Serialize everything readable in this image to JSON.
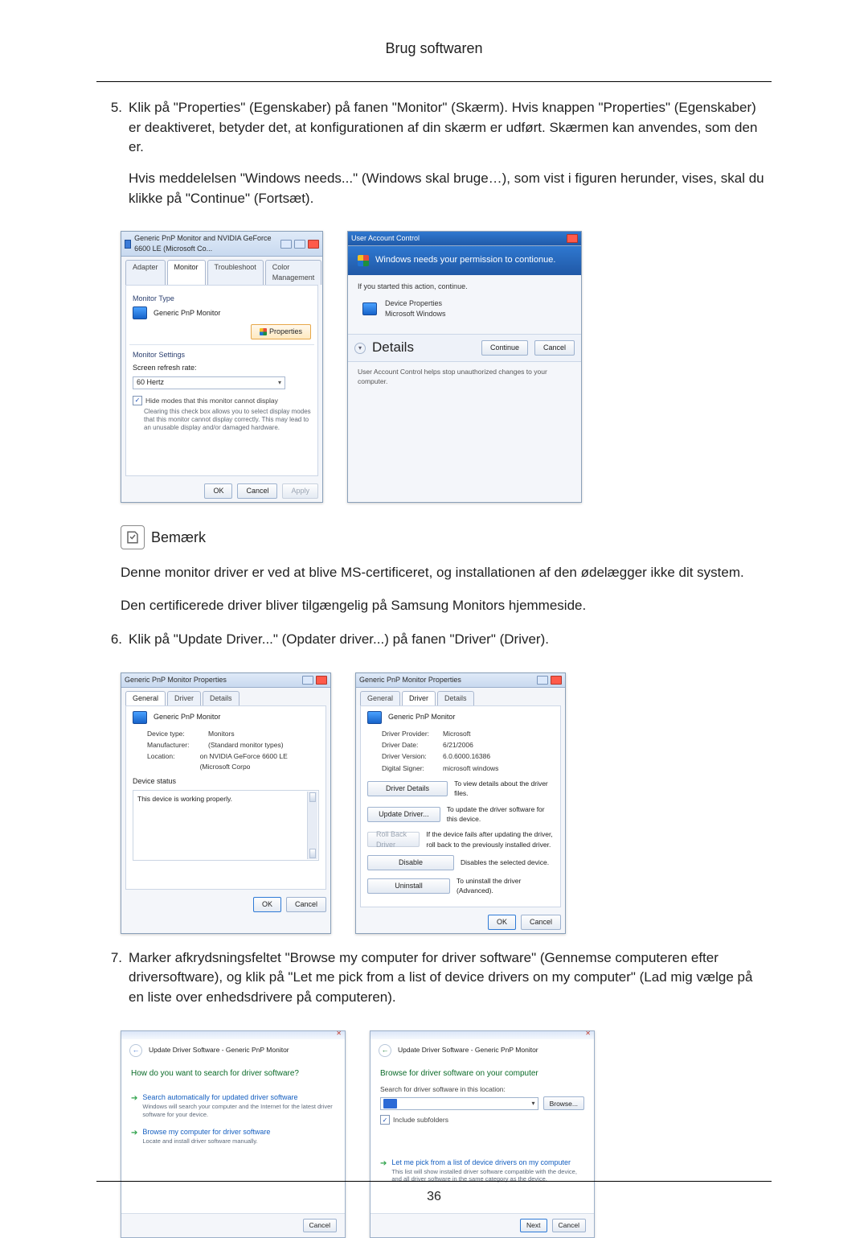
{
  "header": {
    "title": "Brug softwaren"
  },
  "page_number": "36",
  "steps": {
    "five": {
      "num": "5.",
      "para1": "Klik på \"Properties\" (Egenskaber) på fanen \"Monitor\" (Skærm). Hvis knappen \"Properties\" (Egenskaber) er deaktiveret, betyder det, at konfigurationen af din skærm er udført. Skærmen kan anvendes, som den er.",
      "para2": "Hvis meddelelsen \"Windows needs...\" (Windows skal bruge…), som vist i figuren herunder, vises, skal du klikke på \"Continue\" (Fortsæt)."
    },
    "six": {
      "num": "6.",
      "text": "Klik på \"Update Driver...\" (Opdater driver...) på fanen \"Driver\" (Driver)."
    },
    "seven": {
      "num": "7.",
      "text": "Marker afkrydsningsfeltet \"Browse my computer for driver software\" (Gennemse computeren efter driversoftware), og klik på \"Let me pick from a list of device drivers on my computer\" (Lad mig vælge på en liste over enhedsdrivere på computeren)."
    }
  },
  "note": {
    "label": "Bemærk",
    "para1": "Denne monitor driver er ved at blive MS-certificeret, og installationen af den ødelægger ikke dit system.",
    "para2": "Den certificerede driver bliver tilgængelig på Samsung Monitors hjemmeside."
  },
  "fig1_monitor_tab": {
    "title": "Generic PnP Monitor and NVIDIA GeForce 6600 LE (Microsoft Co...",
    "tabs": {
      "adapter": "Adapter",
      "monitor": "Monitor",
      "trouble": "Troubleshoot",
      "color": "Color Management"
    },
    "monitor_type_label": "Monitor Type",
    "monitor_type_value": "Generic PnP Monitor",
    "properties_btn": "Properties",
    "monitor_settings_label": "Monitor Settings",
    "refresh_label": "Screen refresh rate:",
    "refresh_value": "60 Hertz",
    "hide_modes": "Hide modes that this monitor cannot display",
    "hide_modes_hint": "Clearing this check box allows you to select display modes that this monitor cannot display correctly. This may lead to an unusable display and/or damaged hardware.",
    "ok": "OK",
    "cancel": "Cancel",
    "apply": "Apply"
  },
  "fig2_uac": {
    "title": "User Account Control",
    "banner": "Windows needs your permission to contionue.",
    "if_started": "If you started this action, continue.",
    "app_name": "Device Properties",
    "publisher": "Microsoft Windows",
    "details": "Details",
    "continue": "Continue",
    "cancel": "Cancel",
    "footnote": "User Account Control helps stop unauthorized changes to your computer."
  },
  "fig3_general": {
    "title": "Generic PnP Monitor Properties",
    "tabs": {
      "general": "General",
      "driver": "Driver",
      "details": "Details"
    },
    "device": "Generic PnP Monitor",
    "kv": {
      "type_k": "Device type:",
      "type_v": "Monitors",
      "mfr_k": "Manufacturer:",
      "mfr_v": "(Standard monitor types)",
      "loc_k": "Location:",
      "loc_v": "on NVIDIA GeForce 6600 LE (Microsoft Corpo"
    },
    "status_label": "Device status",
    "status_text": "This device is working properly.",
    "ok": "OK",
    "cancel": "Cancel"
  },
  "fig4_driver": {
    "title": "Generic PnP Monitor Properties",
    "tabs": {
      "general": "General",
      "driver": "Driver",
      "details": "Details"
    },
    "device": "Generic PnP Monitor",
    "kv": {
      "prov_k": "Driver Provider:",
      "prov_v": "Microsoft",
      "date_k": "Driver Date:",
      "date_v": "6/21/2006",
      "ver_k": "Driver Version:",
      "ver_v": "6.0.6000.16386",
      "sign_k": "Digital Signer:",
      "sign_v": "microsoft windows"
    },
    "btn_details": "Driver Details",
    "btn_details_d": "To view details about the driver files.",
    "btn_update": "Update Driver...",
    "btn_update_d": "To update the driver software for this device.",
    "btn_roll": "Roll Back Driver",
    "btn_roll_d": "If the device fails after updating the driver, roll back to the previously installed driver.",
    "btn_disable": "Disable",
    "btn_disable_d": "Disables the selected device.",
    "btn_uninstall": "Uninstall",
    "btn_uninstall_d": "To uninstall the driver (Advanced).",
    "ok": "OK",
    "cancel": "Cancel"
  },
  "fig5_wiz_search": {
    "crumb": "Update Driver Software - Generic PnP Monitor",
    "heading": "How do you want to search for driver software?",
    "opt1_title": "Search automatically for updated driver software",
    "opt1_sub": "Windows will search your computer and the Internet for the latest driver software for your device.",
    "opt2_title": "Browse my computer for driver software",
    "opt2_sub": "Locate and install driver software manually.",
    "cancel": "Cancel"
  },
  "fig6_wiz_browse": {
    "crumb": "Update Driver Software - Generic PnP Monitor",
    "heading": "Browse for driver software on your computer",
    "path_label": "Search for driver software in this location:",
    "browse_btn": "Browse...",
    "include": "Include subfolders",
    "opt_title": "Let me pick from a list of device drivers on my computer",
    "opt_sub": "This list will show installed driver software compatible with the device, and all driver software in the same category as the device.",
    "next": "Next",
    "cancel": "Cancel"
  }
}
